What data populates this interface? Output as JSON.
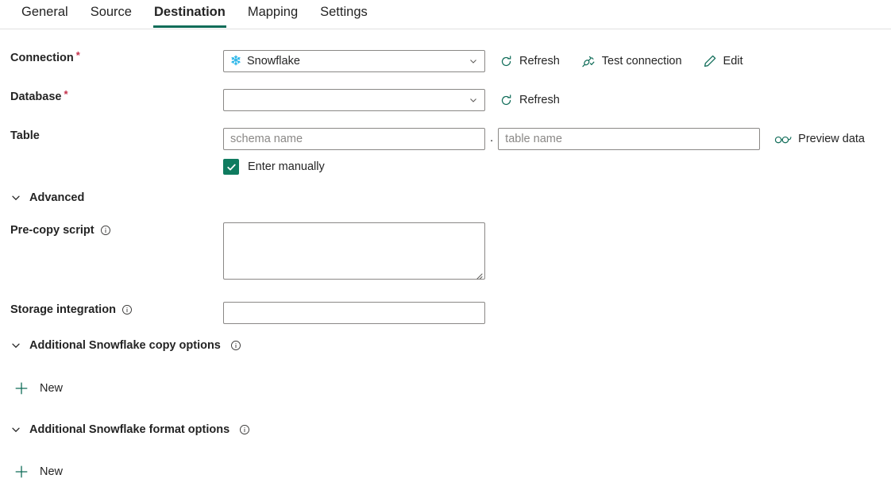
{
  "tabs": [
    {
      "label": "General",
      "active": false
    },
    {
      "label": "Source",
      "active": false
    },
    {
      "label": "Destination",
      "active": true
    },
    {
      "label": "Mapping",
      "active": false
    },
    {
      "label": "Settings",
      "active": false
    }
  ],
  "colors": {
    "accent": "#0f6c58",
    "checkbox": "#0f7b5f",
    "required": "#c4314b",
    "snowflake": "#29b5e8",
    "border": "#8a8886",
    "placeholder": "#8a8886",
    "text": "#242424"
  },
  "connection": {
    "label": "Connection",
    "required": "*",
    "value": "Snowflake",
    "icon": "snowflake-icon",
    "actions": [
      {
        "label": "Refresh",
        "icon": "refresh-icon"
      },
      {
        "label": "Test connection",
        "icon": "plug-check-icon"
      },
      {
        "label": "Edit",
        "icon": "pencil-icon"
      }
    ]
  },
  "database": {
    "label": "Database",
    "required": "*",
    "value": "",
    "placeholder": "",
    "actions": [
      {
        "label": "Refresh",
        "icon": "refresh-icon"
      }
    ]
  },
  "table": {
    "label": "Table",
    "schema_placeholder": "schema name",
    "schema_value": "",
    "separator": ".",
    "table_placeholder": "table name",
    "table_value": "",
    "preview": {
      "label": "Preview data",
      "icon": "glasses-icon"
    },
    "enter_manually": {
      "label": "Enter manually",
      "checked": true
    }
  },
  "advanced": {
    "label": "Advanced",
    "expanded": true
  },
  "pre_copy_script": {
    "label": "Pre-copy script",
    "info": "info-icon",
    "value": ""
  },
  "storage_integration": {
    "label": "Storage integration",
    "info": "info-icon",
    "value": "",
    "placeholder": ""
  },
  "copy_options": {
    "label": "Additional Snowflake copy options",
    "info": "info-icon",
    "expanded": true,
    "new_label": "New"
  },
  "format_options": {
    "label": "Additional Snowflake format options",
    "info": "info-icon",
    "expanded": true,
    "new_label": "New"
  }
}
